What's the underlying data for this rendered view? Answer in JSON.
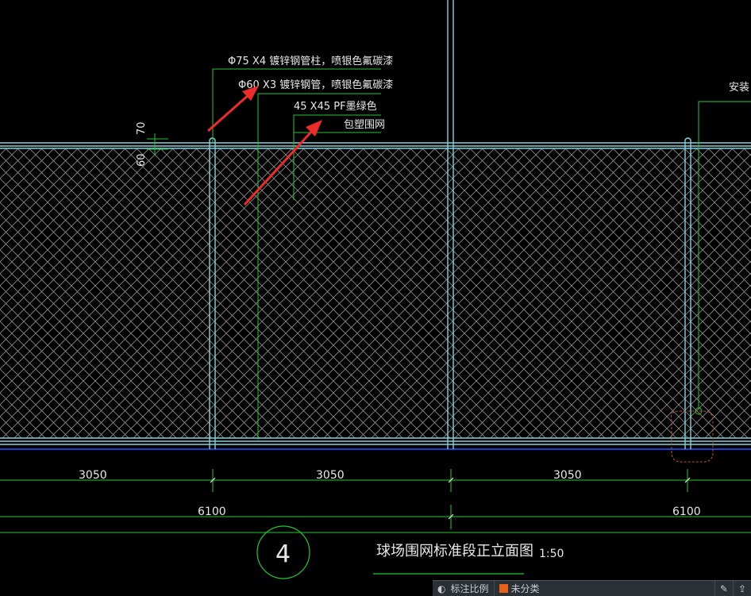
{
  "drawing": {
    "title": "球场围网标准段正立面图",
    "scale": "1:50",
    "detail_number": "4"
  },
  "annotations": {
    "post": "Φ75 X4 镀锌钢管柱，喷银色氟碳漆",
    "pipe": "Φ60 X3 镀锌钢管，喷银色氟碳漆",
    "mesh_spec": "45 X45 PF墨绿色",
    "mesh_type": "包塑围网",
    "install_note": "安装",
    "dim_70": "70",
    "dim_60": "60"
  },
  "dimensions": {
    "segments": [
      "3050",
      "3050",
      "3050"
    ],
    "spans": [
      "6100",
      "6100"
    ]
  },
  "statusbar": {
    "annotation_scale_label": "标注比例",
    "layer_label": "未分类"
  },
  "colors": {
    "background": "#000000",
    "frame": "#7fd4dc",
    "leader": "#22c832",
    "dimension": "#22c832",
    "text": "#e8e8e8",
    "mesh": "#8a8a8a",
    "arrow": "#ee2b2b",
    "revision_cloud": "#c0503a",
    "ground": "#1a3dd6"
  }
}
